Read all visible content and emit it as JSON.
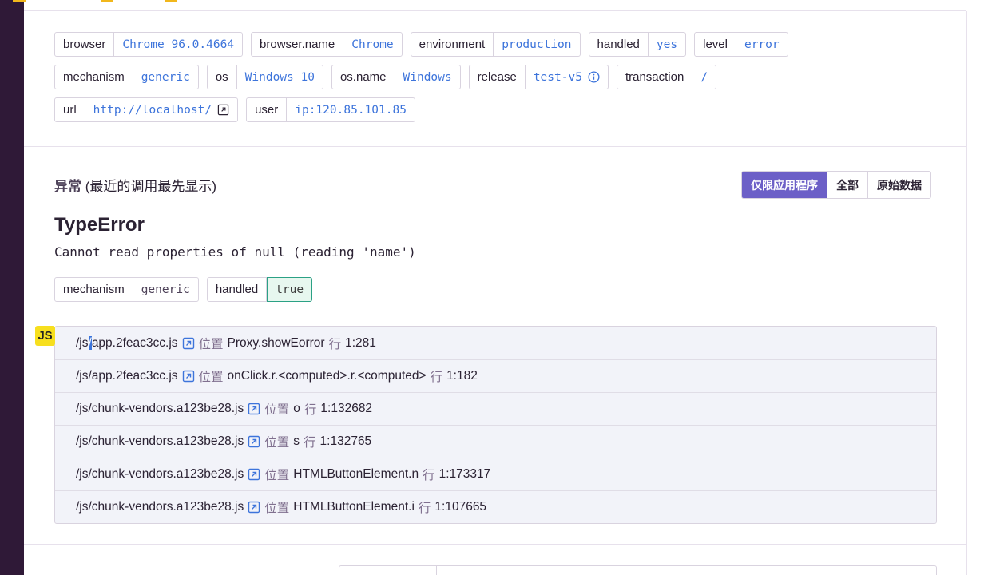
{
  "tags_row1": [
    {
      "key": "browser",
      "value": "Chrome 96.0.4664"
    },
    {
      "key": "browser.name",
      "value": "Chrome"
    },
    {
      "key": "environment",
      "value": "production"
    },
    {
      "key": "handled",
      "value": "yes"
    },
    {
      "key": "level",
      "value": "error"
    }
  ],
  "tags_row2": [
    {
      "key": "mechanism",
      "value": "generic"
    },
    {
      "key": "os",
      "value": "Windows 10"
    },
    {
      "key": "os.name",
      "value": "Windows"
    },
    {
      "key": "release",
      "value": "test-v5",
      "icon": "info-icon"
    },
    {
      "key": "transaction",
      "value": "/"
    }
  ],
  "tags_row3": [
    {
      "key": "url",
      "value": "http://localhost/",
      "icon": "external-link-icon"
    },
    {
      "key": "user",
      "value": "ip:120.85.101.85"
    }
  ],
  "exception": {
    "section_title_bold": "异常",
    "section_title_rest": " (最近的调用最先显示)",
    "buttons": [
      "仅限应用程序",
      "全部",
      "原始数据"
    ],
    "type": "TypeError",
    "message": "Cannot read properties of null (reading 'name')",
    "mechanism_key": "mechanism",
    "mechanism_value": "generic",
    "handled_key": "handled",
    "handled_value": "true",
    "platform_badge": "JS"
  },
  "frames": [
    {
      "file_pre": "/js",
      "file_sel": "/",
      "file_post": "app.2feac3cc.js",
      "at": "位置",
      "fn": "Proxy.showEorror",
      "line_label": "行",
      "pos": "1:281"
    },
    {
      "file_pre": "/js/app.2feac3cc.js",
      "file_sel": "",
      "file_post": "",
      "at": "位置",
      "fn": "onClick.r.<computed>.r.<computed>",
      "line_label": "行",
      "pos": "1:182"
    },
    {
      "file_pre": "/js/chunk-vendors.a123be28.js",
      "file_sel": "",
      "file_post": "",
      "at": "位置",
      "fn": "o",
      "line_label": "行",
      "pos": "1:132682"
    },
    {
      "file_pre": "/js/chunk-vendors.a123be28.js",
      "file_sel": "",
      "file_post": "",
      "at": "位置",
      "fn": "s",
      "line_label": "行",
      "pos": "1:132765"
    },
    {
      "file_pre": "/js/chunk-vendors.a123be28.js",
      "file_sel": "",
      "file_post": "",
      "at": "位置",
      "fn": "HTMLButtonElement.n",
      "line_label": "行",
      "pos": "1:173317"
    },
    {
      "file_pre": "/js/chunk-vendors.a123be28.js",
      "file_sel": "",
      "file_post": "",
      "at": "位置",
      "fn": "HTMLButtonElement.i",
      "line_label": "行",
      "pos": "1:107665"
    }
  ],
  "colors": {
    "accent": "#6c5fc7",
    "link": "#3d74db",
    "sidebar": "#2f1937",
    "handled_bg": "#e7f7ef",
    "js_badge": "#f7df1e"
  }
}
